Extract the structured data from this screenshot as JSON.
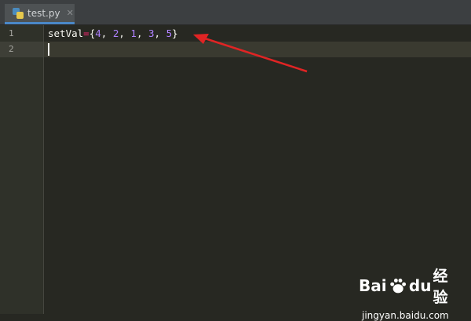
{
  "editor": {
    "tab": {
      "filename": "test.py",
      "close_glyph": "✕"
    },
    "line_numbers": [
      "1",
      "2"
    ],
    "code_line_1": {
      "var": "setVal",
      "op": "=",
      "open": "{",
      "nums": [
        "4",
        "2",
        "1",
        "3",
        "5"
      ],
      "sep": ", ",
      "close": "}"
    },
    "colors": {
      "background": "#272822",
      "keyword": "#f92672",
      "number": "#ae81ff",
      "arrow": "#e02424"
    }
  },
  "watermark": {
    "logo_text_bai": "Bai",
    "logo_text_du": "du",
    "logo_text_cn": "经验",
    "url": "jingyan.baidu.com"
  }
}
